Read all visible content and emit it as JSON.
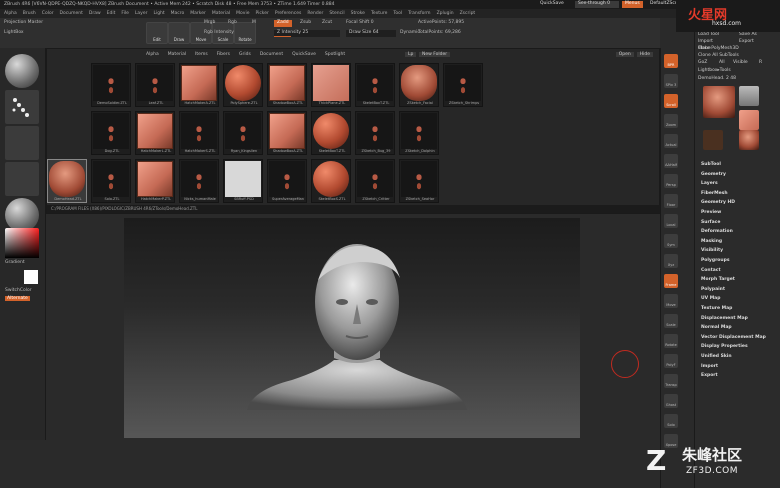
{
  "titlebar": {
    "title": "ZBrush 4R6 [V6VN-QDPE-QDZQ-NKQD-HVX8]   ZBrush Document   • Active Mem 242 • Scratch Disk 48 • Free Mem 3753 • ZTime 1.649 Timer 0.884",
    "quicksave": "QuickSave",
    "seethrough": "See-through  0",
    "menus": "Menus",
    "default": "DefaultZScript"
  },
  "menubar": [
    "Alpha",
    "Brush",
    "Color",
    "Document",
    "Draw",
    "Edit",
    "File",
    "Layer",
    "Light",
    "Macro",
    "Marker",
    "Material",
    "Movie",
    "Picker",
    "Preferences",
    "Render",
    "Stencil",
    "Stroke",
    "Texture",
    "Tool",
    "Transform",
    "Zplugin",
    "Zscript"
  ],
  "shelf": {
    "projection_master": "Projection Master",
    "lightbox": "LightBox",
    "edit": "Edit",
    "draw": "Draw",
    "move": "Move",
    "scale": "Scale",
    "rotate": "Rotate",
    "mrgb": "Mrgb",
    "rgb": "Rgb",
    "m": "M",
    "rgb_intensity": "Rgb Intensity",
    "zadd": "Zadd",
    "zsub": "Zsub",
    "zcut": "Zcut",
    "z_intensity": "Z Intensity 25",
    "focal_shift": "Focal Shift 0",
    "draw_size": "Draw Size 64",
    "dynamic": "Dynamic",
    "active_points": "ActivePoints: 57,895",
    "total_points": "TotalPoints: 69,286",
    "z_intensity_level": 0.25
  },
  "popup": {
    "tabs": [
      "Alpha",
      "Material",
      "Items",
      "Fibers",
      "Grids",
      "Document",
      "QuickSave",
      "Spotlight"
    ],
    "lf": "Lp",
    "new_folder": "New Folder",
    "sys_buttons": [
      "Open",
      "Hide"
    ],
    "path": "C:/PROGRAM FILES (X86)/PIXOLOGIC/ZBRUSH 4R6/ZTools/DemoHead.ZTL",
    "thumbs": [
      {
        "cap": "DemoSoldier.ZTL",
        "kind": "fig"
      },
      {
        "cap": "Leaf.ZTL",
        "kind": "fig"
      },
      {
        "cap": "HatchMakerA.ZTL",
        "kind": "cube"
      },
      {
        "cap": "PolySphere.ZTL",
        "kind": "sphere"
      },
      {
        "cap": "ShadowBoxA.ZTL",
        "kind": "cube"
      },
      {
        "cap": "ThickPlane.ZTL",
        "kind": "plane"
      },
      {
        "cap": "SkeletBoxT.ZTL",
        "kind": "fig"
      },
      {
        "cap": "ZSketch_Facial",
        "kind": "head"
      },
      {
        "cap": "ZSketch_Shrimps",
        "kind": "fig"
      },
      {
        "cap": "Dog.ZTL",
        "kind": "fig"
      },
      {
        "cap": "HatchMakerL.ZTL",
        "kind": "cube"
      },
      {
        "cap": "HatchMakerS.ZTL",
        "kind": "fig"
      },
      {
        "cap": "Ryan_Kingslien",
        "kind": "fig"
      },
      {
        "cap": "ShadowBoxA.ZTL",
        "kind": "cube"
      },
      {
        "cap": "SkeletBoxT.ZTL",
        "kind": "sphere"
      },
      {
        "cap": "ZSketch_Bug_39",
        "kind": "fig"
      },
      {
        "cap": "ZSketch_Dolphin",
        "kind": "fig"
      },
      {
        "cap": "DemoHead.ZTL",
        "kind": "head"
      },
      {
        "cap": "Solo.ZTL",
        "kind": "fig"
      },
      {
        "cap": "HatchMakerP.ZTL",
        "kind": "cube"
      },
      {
        "cap": "Nicks_humanMale",
        "kind": "fig"
      },
      {
        "cap": "SBRuff.PSD",
        "kind": "white"
      },
      {
        "cap": "SuperAverageMan",
        "kind": "fig"
      },
      {
        "cap": "SkeletBoxS.ZTL",
        "kind": "sphere"
      },
      {
        "cap": "ZSketch_Critter",
        "kind": "fig"
      },
      {
        "cap": "ZSketch_SeaHor",
        "kind": "fig"
      }
    ]
  },
  "leftbar": {
    "gradient": "Gradient",
    "switchcolor": "SwitchColor",
    "alternate": "Alternate",
    "swatch_main": "#ff3a3a",
    "swatch_secondary": "#ffffff"
  },
  "rstrip": [
    "BPR",
    "SPix 3",
    "Scroll",
    "Zoom",
    "Actual",
    "AAHalf",
    "Persp",
    "Floor",
    "Local",
    "Sym",
    "Xyz",
    "Frame",
    "Move",
    "Scale",
    "Rotate",
    "PolyF",
    "Transp",
    "Ghost",
    "Solo",
    "Xpose"
  ],
  "rpanel": {
    "buttons": [
      "Load Tool",
      "Save As",
      "Import",
      "Export",
      "Clone",
      "Make PolyMesh3D",
      "Clone All SubTools"
    ],
    "goz": "GoZ",
    "all": "All",
    "visible": "Visible",
    "r": "R",
    "lightbox_tools": "Lightbox▸Tools",
    "demohead": "DemoHead. 2 48",
    "tool_labels": [
      "DemoHead",
      "CylinderBo",
      "PolyMesh3D",
      "SimpleBrush",
      "DemoHead",
      "DemoHead_2"
    ],
    "menu": [
      "SubTool",
      "Geometry",
      "Layers",
      "FiberMesh",
      "Geometry HD",
      "Preview",
      "Surface",
      "Deformation",
      "Masking",
      "Visibility",
      "Polygroups",
      "Contact",
      "Morph Target",
      "Polypaint",
      "UV Map",
      "Texture Map",
      "Displacement Map",
      "Normal Map",
      "Vector Displacement Map",
      "Display Properties",
      "Unified Skin",
      "Import",
      "Export"
    ]
  },
  "logo": {
    "big": "火星网",
    "url": "hxsd.com"
  },
  "watermark": {
    "cn": "朱峰社区",
    "en": "ZF3D.COM",
    "z": "Z"
  },
  "colors": {
    "accent": "#d3622a",
    "panel": "#2b2b2b"
  }
}
